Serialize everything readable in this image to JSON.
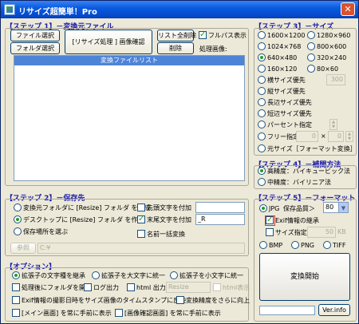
{
  "window": {
    "title": "リサイズ超簡単！Pro",
    "close_glyph": "✕"
  },
  "step1": {
    "title": "【ステップ 1】－変換元ファイル",
    "file_select": "ファイル選択",
    "folder_select": "フォルダ選択",
    "resize_check": "[リサイズ処理 ] 画像確認",
    "list_clear": "リスト全削除",
    "delete": "削除",
    "fullpath": "フルパス表示",
    "processing_image": "処理画像:",
    "list_header": "変換ファイルリスト"
  },
  "step2": {
    "title": "【ステップ 2】－保存先",
    "opt_source_folder": "変換元フォルダに [Resize] フォルダ を作成",
    "opt_desktop": "デスクトップに [Resize] フォルダ を作成",
    "opt_choose": "保存場所を選ぶ",
    "browse": "参照",
    "path": "C:¥",
    "prefix": "先頭文字を付加",
    "suffix": "末尾文字を付加",
    "suffix_value": "_R",
    "bulk_rename": "名前一括変換"
  },
  "step3": {
    "title": "【ステップ 3】－サイズ",
    "sizes": [
      "1600×1200",
      "1280×960",
      "1024×768",
      "800×600",
      "640×480",
      "320×240",
      "160×120",
      "80×60"
    ],
    "width_priority": "横サイズ優先",
    "width_value": "300",
    "height_priority": "縦サイズ優先",
    "long_priority": "長辺サイズ優先",
    "short_priority": "短辺サイズ優先",
    "percent": "パーセント指定",
    "free": "フリー指定",
    "free_x": "0",
    "free_sep": "×",
    "free_y": "0",
    "original": "元サイズ［フォーマット変換］"
  },
  "step4": {
    "title": "【ステップ 4】－補間方法",
    "high": "高精度：バイキュービック法",
    "medium": "中精度：バイリニア法"
  },
  "step5": {
    "title": "【ステップ 5】－フォーマット",
    "jpg": "JPG",
    "quality_label": "保存品質＞",
    "quality_value": "80",
    "exif": "Exif情報の継承",
    "size_spec": "サイズ指定",
    "size_value": "50",
    "size_unit": "KB",
    "bmp": "BMP",
    "png": "PNG",
    "tiff": "TIFF",
    "start": "変換開始",
    "ver": "Ver.info"
  },
  "options": {
    "title": "【オプション】",
    "keep_case": "拡張子の文字種を継承",
    "upper": "拡張子を大文字に統一",
    "lower": "拡張子を小文字に統一",
    "open_folder": "処理後にフォルダを開く",
    "log": "ログ出力",
    "html": "html 出力",
    "html_field": "Resize",
    "html_show": "html表示",
    "exif_time": "Exif情報の撮影日時をサイズ画像のタイムスタンプに反映",
    "precision": "変換精度をさらに向上",
    "main_front": "[メイン画面] を常に手前に表示",
    "confirm_front": "[画像確認画面] を常に手前に表示"
  }
}
